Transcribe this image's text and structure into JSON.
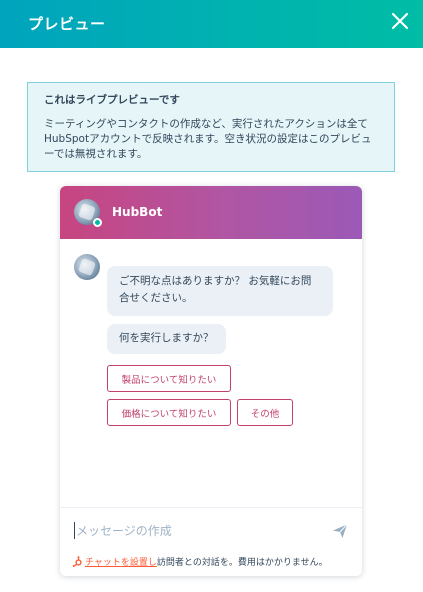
{
  "header": {
    "title": "プレビュー",
    "close_icon": "close-icon",
    "colors": {
      "start": "#00a4bd",
      "end": "#00bda5"
    }
  },
  "notice": {
    "title": "これはライブプレビューです",
    "body": "ミーティングやコンタクトの作成など、実行されたアクションは全てHubSpotアカウントで反映されます。空き状況の設定はこのプレビューでは無視されます。"
  },
  "chat": {
    "bot_name": "HubBot",
    "header_colors": {
      "start": "#c74580",
      "end": "#9b59b6"
    },
    "messages": [
      {
        "text": "ご不明な点はありますか？ お気軽にお問合せください。"
      },
      {
        "text": "何を実行しますか？"
      }
    ],
    "quick_replies": [
      {
        "label": "製品について知りたい"
      },
      {
        "label": "価格について知りたい"
      },
      {
        "label": "その他"
      }
    ],
    "input": {
      "placeholder": "メッセージの作成"
    },
    "send_icon": "send-icon",
    "footer": {
      "icon": "hubspot-sprocket-icon",
      "link": "チャットを設置し",
      "text": "訪問者との対話を。費用はかかりません。"
    }
  }
}
